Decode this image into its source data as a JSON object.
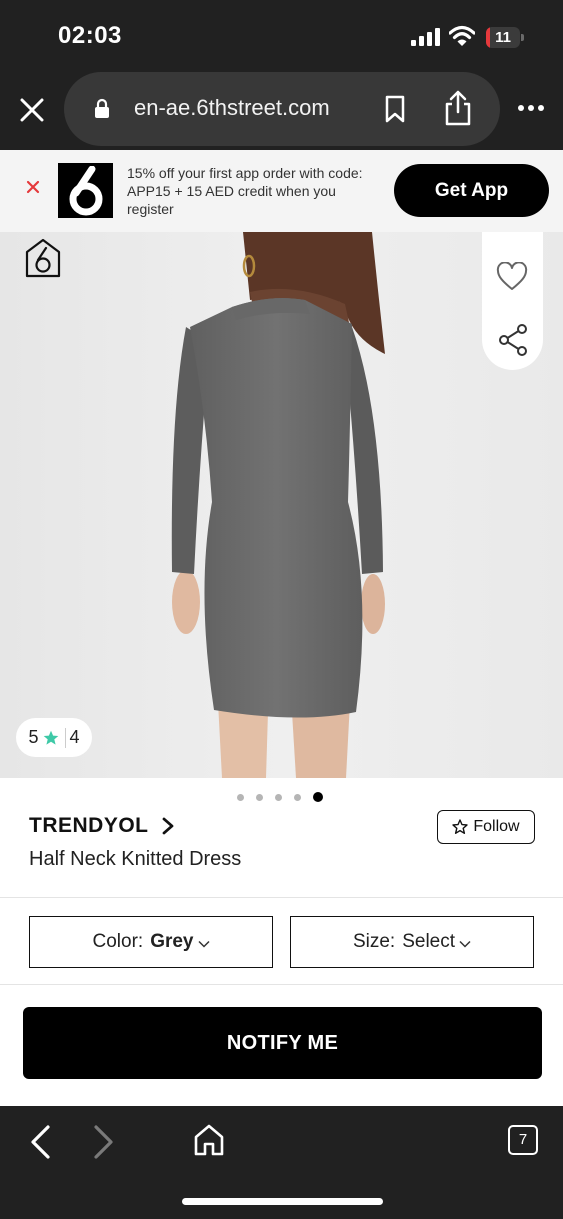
{
  "status_bar": {
    "time": "02:03",
    "battery_level": "11",
    "battery_fraction": 0.11,
    "battery_color": "#e5393c"
  },
  "browser": {
    "url": "en-ae.6thstreet.com",
    "icons": [
      "close-icon",
      "lock-icon",
      "bookmark-icon",
      "share-icon",
      "more-icon"
    ],
    "tab_count": "7"
  },
  "app_banner": {
    "message": "15% off your first app order with code: APP15 + 15 AED credit when you register",
    "cta_label": "Get App",
    "logo_text": "6"
  },
  "gallery": {
    "image_count": 5,
    "active_index": 5,
    "rating": {
      "score": "5",
      "count": "4",
      "star_color": "#3ec9a7"
    }
  },
  "product": {
    "brand": "TRENDYOL",
    "title": "Half Neck Knitted Dress",
    "follow_label": "Follow"
  },
  "selectors": {
    "color_label": "Color:",
    "color_value": "Grey",
    "size_label": "Size:",
    "size_value": "Select"
  },
  "actions": {
    "notify_label": "NOTIFY ME"
  },
  "colors": {
    "chrome_dark": "#212121",
    "url_pill": "#383838",
    "accent_red": "#e5393c",
    "accent_teal": "#3ec9a7"
  }
}
